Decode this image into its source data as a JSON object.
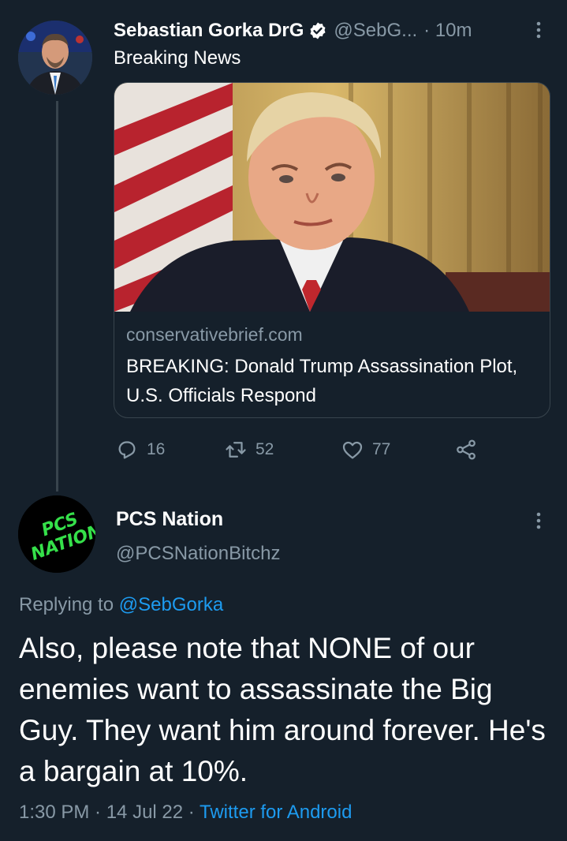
{
  "tweet": {
    "author": {
      "name": "Sebastian Gorka DrG",
      "handle": "@SebG...",
      "time": "· 10m"
    },
    "text": "Breaking News",
    "card": {
      "domain": "conservativebrief.com",
      "title": "BREAKING: Donald Trump Assassination Plot, U.S. Officials Respond"
    },
    "actions": {
      "replies": "16",
      "retweets": "52",
      "likes": "77"
    }
  },
  "reply": {
    "author": {
      "name": "PCS Nation",
      "handle": "@PCSNationBitchz",
      "avatar_text_line1": "PCS",
      "avatar_text_line2": "NATION"
    },
    "replying_to_label": "Replying to",
    "replying_to_mention": "@SebGorka",
    "text": "Also, please note that NONE of our enemies want to assassinate the Big Guy. They want him around forever. He's a bargain at 10%.",
    "timestamp": "1:30 PM · 14 Jul 22 ·",
    "source": "Twitter for Android"
  },
  "colors": {
    "background": "#15202b",
    "secondary_text": "#8899a6",
    "link": "#1d9bf0",
    "divider": "#38444d",
    "avatar_text": "#35e04a"
  },
  "icons": [
    "verified-badge-icon",
    "more-options-icon",
    "reply-icon",
    "retweet-icon",
    "like-icon",
    "share-icon"
  ]
}
